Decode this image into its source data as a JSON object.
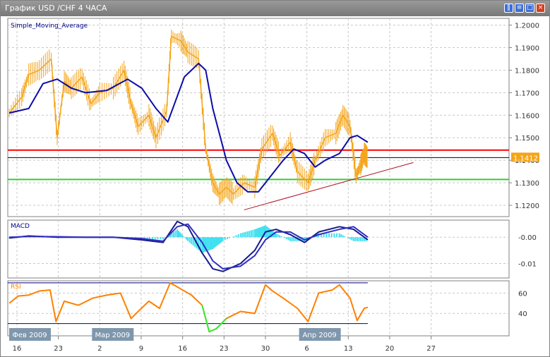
{
  "window": {
    "title": "График USD /CHF  4 ЧАСА",
    "buttons": [
      "tile",
      "restore",
      "maximize",
      "close"
    ]
  },
  "colors": {
    "price": "#f5a418",
    "sma": "#0c0ca8",
    "resistance": "#ff0000",
    "support": "#33cc33",
    "current": "#000000",
    "trend": "#b01020",
    "macd_main": "#1a1a8c",
    "macd_hist": "#40e0f0",
    "rsi": "#ff8000",
    "rsi_low": "#33ee33",
    "level": "#000080"
  },
  "chart_data": [
    {
      "type": "line",
      "title": "Simple_Moving_Average",
      "ylabel": "USD/CHF",
      "ylim": [
        1.115,
        1.203
      ],
      "yticks": [
        "1.2000",
        "1.1900",
        "1.1800",
        "1.1700",
        "1.1600",
        "1.1500",
        "1.1400",
        "1.1300",
        "1.1200"
      ],
      "ytick_values": [
        1.2,
        1.19,
        1.18,
        1.17,
        1.16,
        1.15,
        1.14,
        1.13,
        1.12
      ],
      "current_price_label": "1.1412",
      "current_price": 1.1412,
      "hlines": {
        "resistance": 1.1445,
        "support": 1.1315
      },
      "trendline": {
        "from": [
          38.4,
          1.118
        ],
        "to": [
          67.0,
          1.139
        ]
      },
      "x_unit": "days since Feb 16 2009",
      "series": [
        {
          "name": "Price",
          "x": [
            -1.3,
            0.8,
            2.0,
            3.8,
            5.8,
            6.8,
            8.0,
            9.2,
            11.0,
            12.5,
            14.0,
            16.3,
            18.1,
            19.3,
            20.5,
            22.3,
            23.5,
            25.3,
            26.1,
            27.7,
            28.9,
            30.7,
            31.9,
            33.1,
            34.2,
            35.4,
            36.6,
            38.4,
            40.2,
            41.4,
            43.2,
            44.4,
            46.2,
            47.4,
            49.2,
            50.4,
            52.1,
            53.9,
            55.1,
            56.3,
            57.3,
            58.1,
            58.7,
            59.3
          ],
          "values": [
            1.161,
            1.168,
            1.178,
            1.18,
            1.185,
            1.15,
            1.175,
            1.172,
            1.177,
            1.165,
            1.17,
            1.172,
            1.18,
            1.165,
            1.155,
            1.16,
            1.15,
            1.162,
            1.195,
            1.193,
            1.188,
            1.185,
            1.145,
            1.13,
            1.125,
            1.128,
            1.125,
            1.13,
            1.128,
            1.145,
            1.152,
            1.142,
            1.148,
            1.135,
            1.13,
            1.14,
            1.15,
            1.152,
            1.16,
            1.155,
            1.133,
            1.138,
            1.143,
            1.141
          ]
        },
        {
          "name": "SMA",
          "x": [
            -1.3,
            2.0,
            4.4,
            6.8,
            9.2,
            11.6,
            15.2,
            18.7,
            21.1,
            23.5,
            25.5,
            28.3,
            30.7,
            31.9,
            33.1,
            35.4,
            37.2,
            39.0,
            40.8,
            42.6,
            45.0,
            46.8,
            48.6,
            50.4,
            52.1,
            54.5,
            56.3,
            57.5,
            59.3
          ],
          "values": [
            1.161,
            1.163,
            1.174,
            1.176,
            1.172,
            1.17,
            1.171,
            1.176,
            1.172,
            1.163,
            1.157,
            1.177,
            1.183,
            1.18,
            1.163,
            1.14,
            1.13,
            1.126,
            1.126,
            1.132,
            1.14,
            1.145,
            1.143,
            1.137,
            1.14,
            1.143,
            1.15,
            1.151,
            1.148
          ]
        }
      ]
    },
    {
      "type": "line",
      "title": "MACD",
      "ylim": [
        -0.0155,
        0.0065
      ],
      "yticks": [
        "-0.00",
        "-0.01"
      ],
      "ytick_values": [
        0,
        -0.01
      ],
      "x": [
        -1.3,
        2.0,
        6.8,
        11.6,
        16.3,
        21.1,
        24.7,
        27.1,
        28.9,
        31.3,
        33.1,
        34.8,
        37.8,
        40.2,
        42.0,
        43.8,
        46.2,
        48.6,
        51.0,
        54.5,
        56.9,
        59.3
      ],
      "series": [
        {
          "name": "Main",
          "values": [
            -0.0003,
            0.0005,
            0.0,
            0.0,
            0.0,
            -0.001,
            -0.002,
            0.006,
            0.004,
            -0.006,
            -0.012,
            -0.013,
            -0.01,
            -0.005,
            0.002,
            0.003,
            0.001,
            -0.002,
            0.002,
            0.004,
            0.003,
            -0.001
          ]
        },
        {
          "name": "Signal",
          "values": [
            0.0,
            0.0003,
            0.0002,
            0.0,
            0.0,
            -0.0005,
            -0.0015,
            0.004,
            0.005,
            -0.002,
            -0.009,
            -0.012,
            -0.011,
            -0.007,
            -0.001,
            0.002,
            0.002,
            -0.001,
            0.001,
            0.003,
            0.004,
            0.0
          ]
        }
      ]
    },
    {
      "type": "line",
      "title": "RSI",
      "ylim": [
        18,
        72
      ],
      "yticks": [
        "60",
        "40"
      ],
      "ytick_values": [
        60,
        40
      ],
      "levels": [
        70,
        30
      ],
      "x": [
        -1.3,
        0.2,
        2.0,
        3.8,
        5.6,
        6.6,
        8.0,
        10.4,
        12.8,
        15.2,
        17.5,
        19.3,
        20.5,
        22.3,
        24.1,
        25.9,
        27.7,
        29.5,
        31.3,
        32.5,
        33.7,
        35.4,
        37.8,
        40.2,
        42.0,
        43.2,
        45.0,
        47.4,
        49.2,
        51.0,
        53.3,
        54.5,
        56.3,
        57.5,
        58.7,
        59.3
      ],
      "values": [
        50,
        57,
        58,
        62,
        63,
        32,
        52,
        48,
        55,
        58,
        60,
        35,
        42,
        52,
        45,
        70,
        64,
        58,
        48,
        22,
        25,
        35,
        42,
        40,
        68,
        62,
        55,
        45,
        32,
        60,
        63,
        68,
        55,
        33,
        45,
        46
      ]
    },
    {
      "type": "axis",
      "xticks": [
        "16",
        "23",
        "2",
        "9",
        "16",
        "23",
        "30",
        "6",
        "13",
        "20",
        "27"
      ],
      "xtick_days": [
        0,
        7,
        14,
        21,
        28,
        35,
        42,
        49,
        56,
        63,
        70
      ],
      "months": [
        {
          "label": "Фев 2009",
          "day": 0
        },
        {
          "label": "Мар 2009",
          "day": 14
        },
        {
          "label": "Апр 2009",
          "day": 49
        }
      ]
    }
  ]
}
